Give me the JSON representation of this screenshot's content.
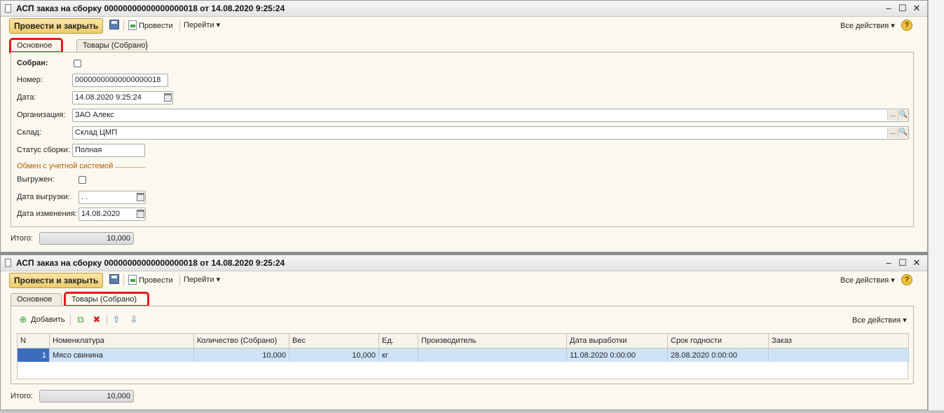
{
  "window1": {
    "title": "АСП заказ на сборку 00000000000000000018 от 14.08.2020 9:25:24",
    "min": "–",
    "max": "☐",
    "close": "✕",
    "toolbar": {
      "post_close": "Провести и закрыть",
      "post": "Провести",
      "goto": "Перейти",
      "all_actions": "Все действия",
      "help": "?"
    },
    "tabs": [
      "Основное",
      "Товары (Собрано)"
    ],
    "form": {
      "collected_label": "Собран:",
      "number_label": "Номер:",
      "number_value": "00000000000000000018",
      "date_label": "Дата:",
      "date_value": "14.08.2020  9:25:24",
      "org_label": "Организация:",
      "org_value": "ЗАО Алекс",
      "warehouse_label": "Склад:",
      "warehouse_value": "Склад ЦМП",
      "status_label": "Статус сборки:",
      "status_value": "Полная",
      "exchange_group": "Обмен с учетной системой",
      "exported_label": "Выгружен:",
      "export_date_label": "Дата выгрузки:",
      "export_date_value": "  .  .",
      "change_date_label": "Дата изменения:",
      "change_date_value": "14.08.2020",
      "dots": "...",
      "search": "🔍"
    },
    "total_label": "Итого:",
    "total_value": "10,000"
  },
  "window2": {
    "title": "АСП заказ на сборку 00000000000000000018 от 14.08.2020 9:25:24",
    "min": "–",
    "max": "☐",
    "close": "✕",
    "toolbar": {
      "post_close": "Провести и закрыть",
      "post": "Провести",
      "goto": "Перейти",
      "all_actions": "Все действия",
      "help": "?"
    },
    "tabs": [
      "Основное",
      "Товары (Собрано)"
    ],
    "grid_toolbar": {
      "add": "Добавить",
      "all_actions": "Все действия",
      "add_icon": "⊕",
      "copy_icon": "⧉",
      "delete_icon": "✖",
      "up_icon": "⇧",
      "down_icon": "⇩"
    },
    "columns": [
      "N",
      "Номенклатура",
      "Количество (Собрано)",
      "Вес",
      "Ед.",
      "Производитель",
      "Дата выработки",
      "Срок годности",
      "Заказ"
    ],
    "rows": [
      {
        "n": "1",
        "item": "Мясо свинина",
        "qty": "10,000",
        "weight": "10,000",
        "unit": "кг",
        "maker": "",
        "prod_date": "11.08.2020 0:00:00",
        "expiry": "28.08.2020 0:00:00",
        "order": ""
      }
    ],
    "total_label": "Итого:",
    "total_value": "10,000"
  }
}
